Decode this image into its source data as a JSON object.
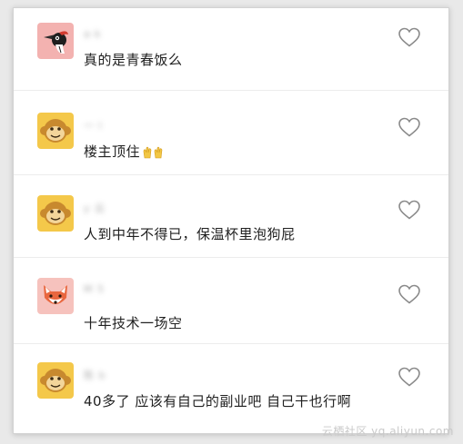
{
  "comments": [
    {
      "username": "a·k",
      "text": "真的是青春饭么",
      "avatar_icon": "woodpecker-icon",
      "avatar_bg": "#f3b2b0"
    },
    {
      "username": "一 l",
      "text": "楼主顶住",
      "emoji_icon": "raised-hands-icon",
      "avatar_icon": "monkey-face-icon",
      "avatar_bg": "#f4c84a"
    },
    {
      "username": "y 云",
      "text": "人到中年不得已，保温杯里泡狗屁",
      "avatar_icon": "monkey-face-icon",
      "avatar_bg": "#f4c84a"
    },
    {
      "username": "M 5",
      "text": "十年技术一场空",
      "avatar_icon": "fox-face-icon",
      "avatar_bg": "#f6c2bd"
    },
    {
      "username": "陈 b",
      "text": "40多了 应该有自己的副业吧 自己干也行啊",
      "avatar_icon": "monkey-face-icon",
      "avatar_bg": "#f4c84a"
    }
  ],
  "like_icon": "heart-outline-icon",
  "watermark": "云栖社区 yq.aliyun.com"
}
